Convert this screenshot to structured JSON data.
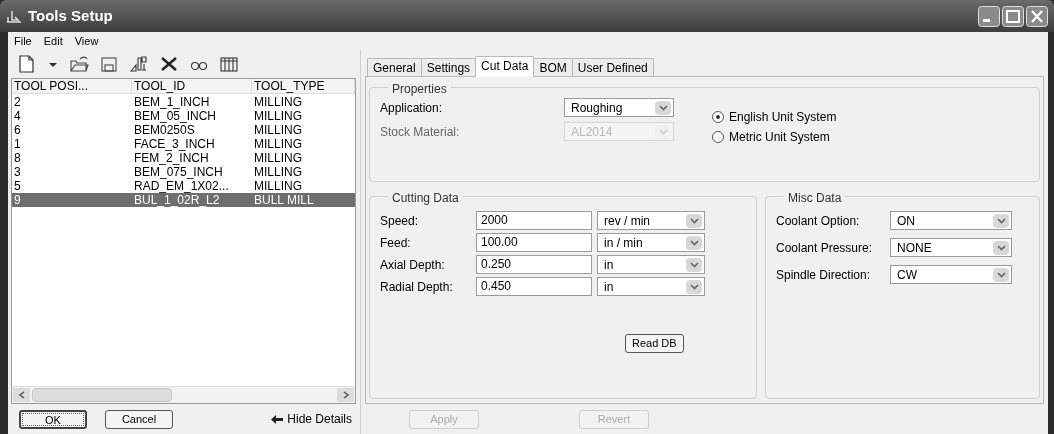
{
  "window": {
    "title": "Tools Setup"
  },
  "menu": [
    "File",
    "Edit",
    "View"
  ],
  "table": {
    "columns": [
      "TOOL POSI...",
      "TOOL_ID",
      "TOOL_TYPE"
    ],
    "rows": [
      {
        "cells": [
          "2",
          "BEM_1_INCH",
          "MILLING"
        ],
        "selected": false
      },
      {
        "cells": [
          "4",
          "BEM_05_INCH",
          "MILLING"
        ],
        "selected": false
      },
      {
        "cells": [
          "6",
          "BEM0250S",
          "MILLING"
        ],
        "selected": false
      },
      {
        "cells": [
          "1",
          "FACE_3_INCH",
          "MILLING"
        ],
        "selected": false
      },
      {
        "cells": [
          "8",
          "FEM_2_INCH",
          "MILLING"
        ],
        "selected": false
      },
      {
        "cells": [
          "3",
          "BEM_075_INCH",
          "MILLING"
        ],
        "selected": false
      },
      {
        "cells": [
          "5",
          "RAD_EM_1X02...",
          "MILLING"
        ],
        "selected": false
      },
      {
        "cells": [
          "9",
          "BUL_1_02R_L2",
          "BULL MILL"
        ],
        "selected": true
      }
    ]
  },
  "dialog_buttons": [
    {
      "label": "OK",
      "default": true
    },
    {
      "label": "Cancel",
      "default": false
    }
  ],
  "hide_details": "Hide Details",
  "tabs": [
    {
      "label": "General",
      "selected": false
    },
    {
      "label": "Settings",
      "selected": false
    },
    {
      "label": "Cut Data",
      "selected": true
    },
    {
      "label": "BOM",
      "selected": false
    },
    {
      "label": "User Defined",
      "selected": false
    }
  ],
  "properties": {
    "title": "Properties",
    "fields": [
      {
        "label": "Application:",
        "value": "Roughing",
        "disabled": false
      },
      {
        "label": "Stock Material:",
        "value": "AL2014",
        "disabled": true
      }
    ],
    "units": [
      {
        "label": "English Unit System",
        "selected": true
      },
      {
        "label": "Metric Unit System",
        "selected": false
      }
    ]
  },
  "cutting_data": {
    "title": "Cutting Data",
    "rows": [
      {
        "label": "Speed:",
        "value": "2000",
        "unit": "rev / min"
      },
      {
        "label": "Feed:",
        "value": "100.00",
        "unit": "in / min"
      },
      {
        "label": "Axial Depth:",
        "value": "0.250",
        "unit": "in"
      },
      {
        "label": "Radial Depth:",
        "value": "0.450",
        "unit": "in"
      }
    ],
    "button": "Read DB"
  },
  "misc_data": {
    "title": "Misc Data",
    "rows": [
      {
        "label": "Coolant Option:",
        "value": "ON"
      },
      {
        "label": "Coolant Pressure:",
        "value": "NONE"
      },
      {
        "label": "Spindle Direction:",
        "value": "CW"
      }
    ]
  },
  "bottom_buttons": [
    {
      "label": "Apply",
      "disabled": true
    },
    {
      "label": "Revert",
      "disabled": true
    }
  ]
}
